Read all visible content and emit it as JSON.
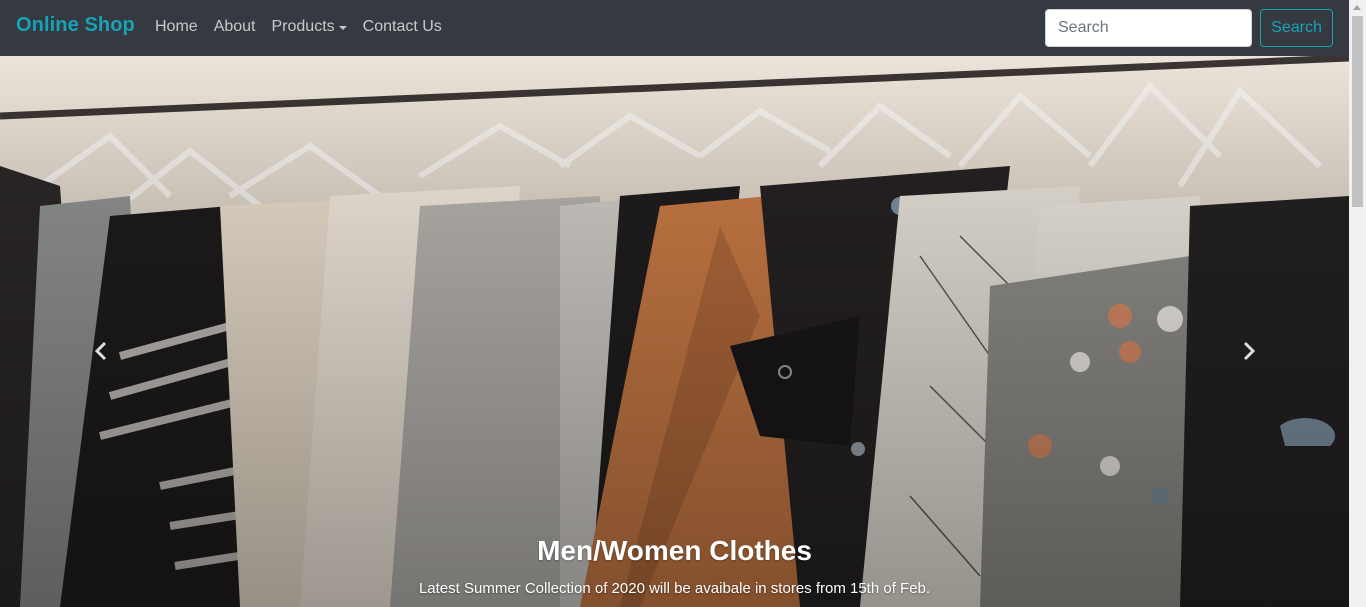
{
  "navbar": {
    "brand": "Online Shop",
    "links": [
      {
        "label": "Home"
      },
      {
        "label": "About"
      },
      {
        "label": "Products",
        "dropdown": true
      },
      {
        "label": "Contact Us"
      }
    ],
    "search": {
      "placeholder": "Search",
      "value": "",
      "button_label": "Search"
    }
  },
  "carousel": {
    "caption_title": "Men/Women Clothes",
    "caption_text": "Latest Summer Collection of 2020 will be avaibale in stores from 15th of Feb.",
    "controls": {
      "prev_icon": "chevron-left-icon",
      "next_icon": "chevron-right-icon"
    }
  },
  "colors": {
    "navbar_bg": "#343a40",
    "accent": "#17a2b8"
  }
}
